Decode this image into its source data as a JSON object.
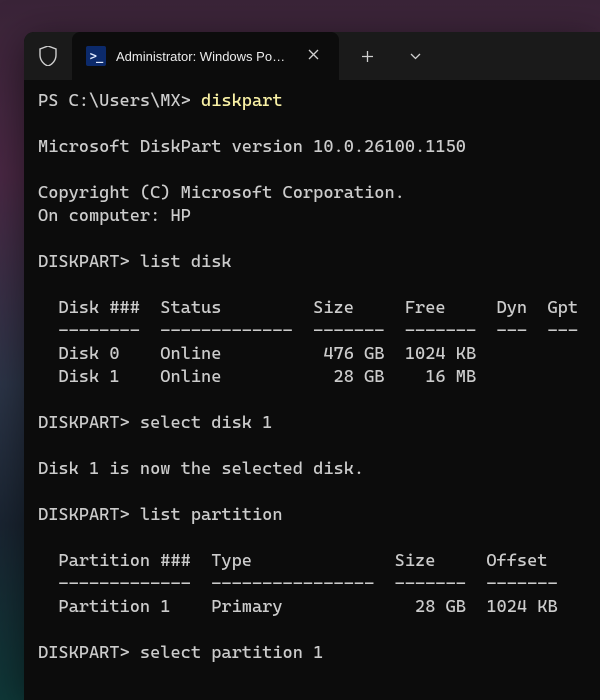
{
  "window": {
    "tab_title": "Administrator: Windows PowerShell"
  },
  "term": {
    "l1_prompt": "PS C:\\Users\\MX> ",
    "l1_cmd": "diskpart",
    "l2": "",
    "l3": "Microsoft DiskPart version 10.0.26100.1150",
    "l4": "",
    "l5": "Copyright (C) Microsoft Corporation.",
    "l6": "On computer: HP",
    "l7": "",
    "l8": "DISKPART> list disk",
    "l9": "",
    "l10": "  Disk ###  Status         Size     Free     Dyn  Gpt",
    "l11": "  --------  -------------  -------  -------  ---  ---",
    "l12": "  Disk 0    Online          476 GB  1024 KB",
    "l13": "  Disk 1    Online           28 GB    16 MB",
    "l14": "",
    "l15": "DISKPART> select disk 1",
    "l16": "",
    "l17": "Disk 1 is now the selected disk.",
    "l18": "",
    "l19": "DISKPART> list partition",
    "l20": "",
    "l21": "  Partition ###  Type              Size     Offset",
    "l22": "  -------------  ----------------  -------  -------",
    "l23": "  Partition 1    Primary             28 GB  1024 KB",
    "l24": "",
    "l25": "DISKPART> select partition 1"
  }
}
